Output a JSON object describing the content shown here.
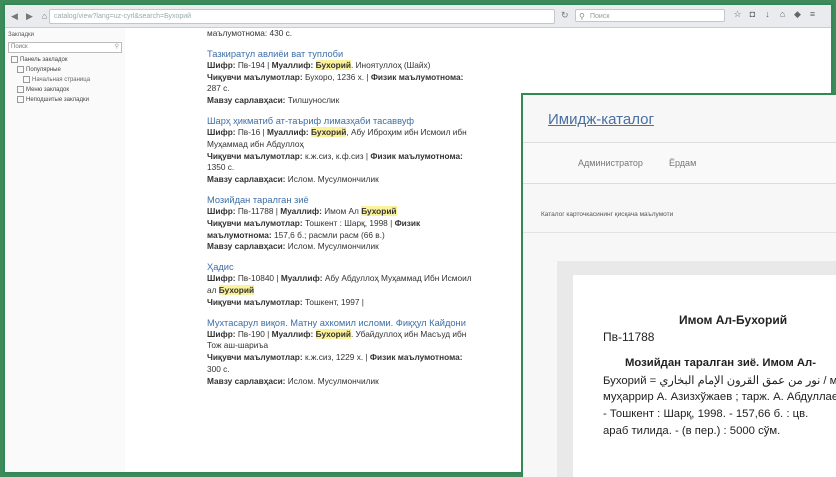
{
  "browser": {
    "url": "catalog/view?lang=uz-cyrl&search=Бухорий",
    "search_placeholder": "Поиск",
    "toolbar_icons": [
      "star-icon",
      "lock-icon",
      "download-icon",
      "home-icon",
      "shield-icon",
      "menu-icon"
    ]
  },
  "sidebar": {
    "header": "Закладки",
    "filter_placeholder": "Поиск",
    "items": [
      {
        "label": "Панель закладок",
        "level": 1
      },
      {
        "label": "Популярные",
        "level": 2
      },
      {
        "label": "Начальная страница",
        "level": 3
      },
      {
        "label": "Меню закладок",
        "level": 2
      },
      {
        "label": "Неподшитые закладки",
        "level": 2
      }
    ]
  },
  "entries": [
    {
      "title": "",
      "lines": [
        {
          "parts": [
            {
              "t": "маълумотнома: 430 с."
            }
          ]
        }
      ]
    },
    {
      "title": "Тазкиратул авлиёи ват туплоби",
      "lines": [
        {
          "parts": [
            {
              "t": "Шифр: ",
              "c": "lbl"
            },
            {
              "t": "Пв-194 | "
            },
            {
              "t": "Муаллиф: ",
              "c": "lbl"
            },
            {
              "t": "Бухорий",
              "c": "hl"
            },
            {
              "t": ". Иноятуллоҳ (Шайх)"
            }
          ]
        },
        {
          "parts": [
            {
              "t": "Чиқувчи маълумотлар: ",
              "c": "lbl"
            },
            {
              "t": "Бухоро, 1236 х. | "
            },
            {
              "t": "Физик маълумотнома:",
              "c": "lbl"
            }
          ]
        },
        {
          "parts": [
            {
              "t": "287 с."
            }
          ]
        },
        {
          "parts": [
            {
              "t": "Мавзу сарлавҳаси: ",
              "c": "lbl"
            },
            {
              "t": "Тилшунослик"
            }
          ]
        }
      ]
    },
    {
      "title": "Шарҳ ҳикматиб ат-таъриф лимазҳаби тасаввуф",
      "lines": [
        {
          "parts": [
            {
              "t": "Шифр: ",
              "c": "lbl"
            },
            {
              "t": "Пв-16 | "
            },
            {
              "t": "Муаллиф: ",
              "c": "lbl"
            },
            {
              "t": "Бухорий",
              "c": "hl"
            },
            {
              "t": ", Абу Иброҳим ибн Исмоил ибн"
            }
          ]
        },
        {
          "parts": [
            {
              "t": "Муҳаммад ибн Абдуллоҳ"
            }
          ]
        },
        {
          "parts": [
            {
              "t": "Чиқувчи маълумотлар: ",
              "c": "lbl"
            },
            {
              "t": "к.ж.сиз, к.ф.сиз | "
            },
            {
              "t": "Физик маълумотнома:",
              "c": "lbl"
            }
          ]
        },
        {
          "parts": [
            {
              "t": "1350 с."
            }
          ]
        },
        {
          "parts": [
            {
              "t": "Мавзу сарлавҳаси: ",
              "c": "lbl"
            },
            {
              "t": "Ислом. Мусулмончилик"
            }
          ]
        }
      ]
    },
    {
      "title": "Мозийдан таралган зиё",
      "lines": [
        {
          "parts": [
            {
              "t": "Шифр: ",
              "c": "lbl"
            },
            {
              "t": "Пв-11788 | "
            },
            {
              "t": "Муаллиф: ",
              "c": "lbl"
            },
            {
              "t": "Имом Ал "
            },
            {
              "t": "Бухорий",
              "c": "hl"
            }
          ]
        },
        {
          "parts": [
            {
              "t": "Чиқувчи маълумотлар: ",
              "c": "lbl"
            },
            {
              "t": "Тошкент : Шарқ, 1998 | "
            },
            {
              "t": "Физик",
              "c": "lbl"
            }
          ]
        },
        {
          "parts": [
            {
              "t": "маълумотнома: ",
              "c": "lbl"
            },
            {
              "t": "157,6 б.; расмли расм (66 в.)"
            }
          ]
        },
        {
          "parts": [
            {
              "t": "Мавзу сарлавҳаси: ",
              "c": "lbl"
            },
            {
              "t": "Ислом. Мусулмончилик"
            }
          ]
        }
      ]
    },
    {
      "title": "Ҳадис",
      "lines": [
        {
          "parts": [
            {
              "t": "Шифр: ",
              "c": "lbl"
            },
            {
              "t": "Пв-10840 | "
            },
            {
              "t": "Муаллиф: ",
              "c": "lbl"
            },
            {
              "t": "Абу Абдуллоҳ Муҳаммад Ибн Исмоил"
            }
          ]
        },
        {
          "parts": [
            {
              "t": "ал "
            },
            {
              "t": "Бухорий",
              "c": "hl"
            }
          ]
        },
        {
          "parts": [
            {
              "t": "Чиқувчи маълумотлар: ",
              "c": "lbl"
            },
            {
              "t": "Тошкент, 1997 |"
            }
          ]
        }
      ]
    },
    {
      "title": "Мухтасарул виқоя. Матну ахкомил исломи. Фиқҳул Кайдони",
      "lines": [
        {
          "parts": [
            {
              "t": "Шифр: ",
              "c": "lbl"
            },
            {
              "t": "Пв-190 | "
            },
            {
              "t": "Муаллиф: ",
              "c": "lbl"
            },
            {
              "t": "Бухорий",
              "c": "hl"
            },
            {
              "t": ". Убайдуллоҳ ибн Масъуд ибн"
            }
          ]
        },
        {
          "parts": [
            {
              "t": "Тож аш-шариъа"
            }
          ]
        },
        {
          "parts": [
            {
              "t": "Чиқувчи маълумотлар: ",
              "c": "lbl"
            },
            {
              "t": "к.ж.сиз, 1229 х. | "
            },
            {
              "t": "Физик маълумотнома:",
              "c": "lbl"
            }
          ]
        },
        {
          "parts": [
            {
              "t": "300 с."
            }
          ]
        },
        {
          "parts": [
            {
              "t": "Мавзу сарлавҳаси: ",
              "c": "lbl"
            },
            {
              "t": "Ислом. Мусулмончилик"
            }
          ]
        }
      ]
    }
  ],
  "popup": {
    "title": "Имидж-каталог",
    "nav": [
      "Администратор",
      "Ёрдам"
    ],
    "subtitle": "Каталог карточкасининг қисқача маълумоти",
    "card": {
      "author": "Имом Ал-Бухорий",
      "code": "Пв-11788",
      "lines": [
        "Мозийдан таралган зиё. Имом Ал-",
        "Бухорий = نور من عمق القرون الإمام البخاري / масъул",
        "муҳаррир А. Азизхўжаев ; тарж. А. Абдуллаев",
        "- Тошкент : Шарқ, 1998. - 157,66 б. : цв.",
        "араб тилида. - (в пер.) : 5000 сўм."
      ]
    }
  }
}
